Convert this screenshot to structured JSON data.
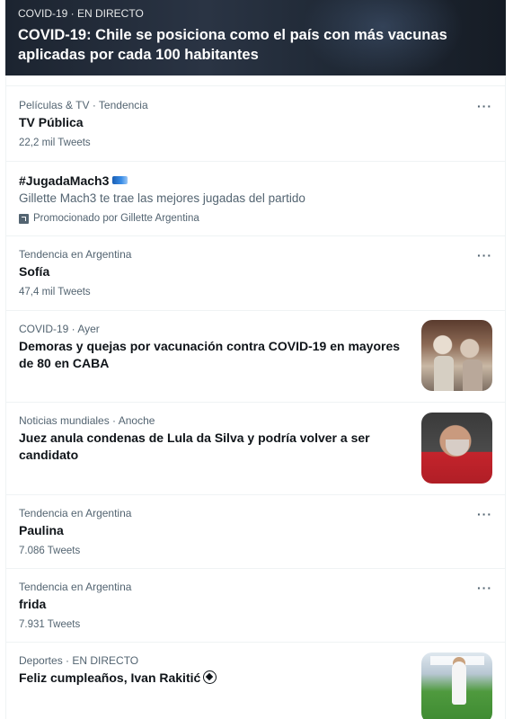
{
  "hero": {
    "meta": "COVID-19 · EN DIRECTO",
    "title": "COVID-19: Chile se posiciona como el país con más vacunas aplicadas por cada 100 habitantes"
  },
  "trends": [
    {
      "meta": "Películas & TV · Tendencia",
      "title": "TV Pública",
      "count": "22,2 mil Tweets",
      "more": "···"
    },
    {
      "hashtag": "#JugadaMach3",
      "description": "Gillette Mach3 te trae las mejores jugadas del partido",
      "promoted": "Promocionado por Gillette Argentina"
    },
    {
      "meta": "Tendencia en Argentina",
      "title": "Sofía",
      "count": "47,4 mil Tweets",
      "more": "···"
    },
    {
      "meta": "COVID-19 · Ayer",
      "title": "Demoras y quejas por vacunación contra COVID-19 en mayores de 80 en CABA",
      "thumb": "elderly-vaccination-photo"
    },
    {
      "meta": "Noticias mundiales · Anoche",
      "title": "Juez anula condenas de Lula da Silva y podría volver a ser candidato",
      "thumb": "lula-portrait-photo"
    },
    {
      "meta": "Tendencia en Argentina",
      "title": "Paulina",
      "count": "7.086 Tweets",
      "more": "···"
    },
    {
      "meta": "Tendencia en Argentina",
      "title": "frida",
      "count": "7.931 Tweets",
      "more": "···"
    },
    {
      "meta": "Deportes · EN DIRECTO",
      "title": "Feliz cumpleaños, Ivan Rakitić",
      "thumb": "football-player-photo",
      "emoji": "soccer-ball-icon"
    }
  ]
}
